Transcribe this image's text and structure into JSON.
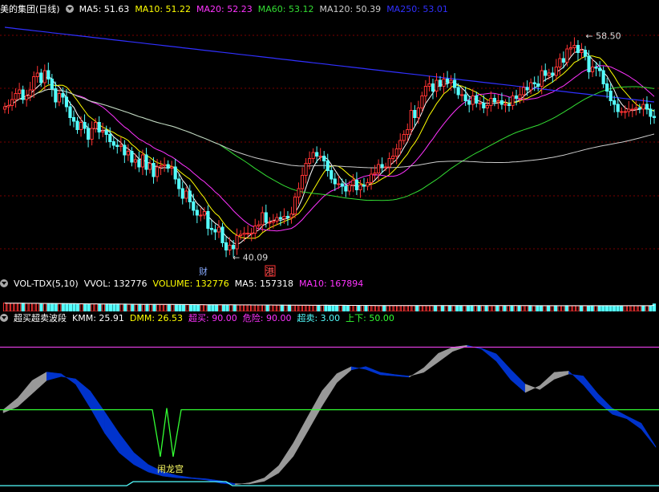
{
  "colors": {
    "up": "#ff3333",
    "down": "#54ffff",
    "ma5": "#ffffff",
    "ma10": "#ffff00",
    "ma20": "#ff33ff",
    "ma60": "#33dd33",
    "ma120": "#cccccc",
    "ma250": "#3030ff",
    "grid": "#7a0000",
    "kdj_up": "#999999",
    "kdj_down": "#0033cc",
    "green_line": "#33ff33",
    "pink_line": "#ff44ff"
  },
  "price_panel": {
    "title": "美的集团(日线)",
    "legend": [
      {
        "label": "MA5: 51.63",
        "color": "#ffffff"
      },
      {
        "label": "MA10: 51.22",
        "color": "#ffff00"
      },
      {
        "label": "MA20: 52.23",
        "color": "#ff33ff"
      },
      {
        "label": "MA60: 53.12",
        "color": "#33dd33"
      },
      {
        "label": "MA120: 50.39",
        "color": "#cccccc"
      },
      {
        "label": "MA250: 53.01",
        "color": "#3030ff"
      }
    ],
    "high_label": "58.50",
    "low_label": "40.09",
    "marker_cai": "财",
    "marker_gang": "港"
  },
  "volume_panel": {
    "legend": [
      {
        "label": "VOL-TDX(5,10)",
        "color": "#ffffff"
      },
      {
        "label": "VVOL: 132776",
        "color": "#ffffff"
      },
      {
        "label": "VOLUME: 132776",
        "color": "#ffff00"
      },
      {
        "label": "MA5: 157318",
        "color": "#ffffff"
      },
      {
        "label": "MA10: 167894",
        "color": "#ff33ff"
      }
    ]
  },
  "indicator_panel": {
    "legend": [
      {
        "label": "超买超卖波段",
        "color": "#ffffff"
      },
      {
        "label": "KMM: 25.91",
        "color": "#ffffff"
      },
      {
        "label": "DMM: 26.53",
        "color": "#ffff00"
      },
      {
        "label": "超买: 90.00",
        "color": "#ff33ff"
      },
      {
        "label": "危险: 90.00",
        "color": "#ff33ff"
      },
      {
        "label": "超卖: 3.00",
        "color": "#54ffff"
      },
      {
        "label": "上下: 50.00",
        "color": "#33ff33"
      }
    ],
    "annotation": "闹龙宫"
  },
  "chart_data": [
    {
      "type": "candlestick",
      "title": "美的集团(日线)",
      "x": [
        1,
        2,
        3,
        4,
        5,
        6,
        7,
        8,
        9,
        10,
        11,
        12,
        13,
        14,
        15,
        16,
        17,
        18,
        19,
        20,
        21,
        22,
        23,
        24,
        25,
        26,
        27,
        28,
        29,
        30,
        31,
        32,
        33,
        34,
        35,
        36,
        37,
        38,
        39,
        40,
        41,
        42,
        43,
        44,
        45,
        46,
        47,
        48,
        49,
        50,
        51,
        52,
        53,
        54,
        55,
        56,
        57,
        58,
        59,
        60,
        61,
        62,
        63,
        64,
        65,
        66,
        67,
        68,
        69,
        70,
        71,
        72,
        73,
        74,
        75,
        76,
        77,
        78,
        79,
        80,
        81,
        82,
        83,
        84,
        85,
        86,
        87,
        88,
        89,
        90,
        91,
        92,
        93,
        94,
        95,
        96,
        97,
        98,
        99,
        100,
        101,
        102,
        103,
        104,
        105,
        106,
        107,
        108,
        109,
        110,
        111,
        112,
        113,
        114,
        115,
        116,
        117,
        118,
        119,
        120,
        121,
        122,
        123,
        124,
        125,
        126,
        127,
        128,
        129,
        130,
        131,
        132,
        133,
        134,
        135,
        136,
        137,
        138,
        139,
        140,
        141,
        142,
        143,
        144,
        145,
        146,
        147,
        148,
        149,
        150,
        151,
        152,
        153,
        154,
        155,
        156,
        157,
        158,
        159,
        160,
        161,
        162,
        163,
        164,
        165,
        166,
        167,
        168,
        169,
        170,
        171,
        172,
        173,
        174,
        175,
        176,
        177,
        178,
        179,
        180
      ],
      "close": [
        52.6,
        52.7,
        53.2,
        53.7,
        54.0,
        53.2,
        53.5,
        54.0,
        55.1,
        55.4,
        54.6,
        55.6,
        54.9,
        54.1,
        53.0,
        53.7,
        53.4,
        52.6,
        51.7,
        51.4,
        50.7,
        51.3,
        50.8,
        49.9,
        50.8,
        51.3,
        50.5,
        50.6,
        50.3,
        49.7,
        49.4,
        49.3,
        49.4,
        48.6,
        48.9,
        48.0,
        48.2,
        47.6,
        48.6,
        47.4,
        47.9,
        46.8,
        47.6,
        47.7,
        47.8,
        47.5,
        47.6,
        46.6,
        45.8,
        45.0,
        45.6,
        44.7,
        44.0,
        43.6,
        43.6,
        43.9,
        42.5,
        42.4,
        42.2,
        42.6,
        41.3,
        40.7,
        41.1,
        40.8,
        41.9,
        42.0,
        42.1,
        42.1,
        42.1,
        42.7,
        42.8,
        43.8,
        43.0,
        43.0,
        43.1,
        43.4,
        43.3,
        43.5,
        43.4,
        43.7,
        45.1,
        45.8,
        46.9,
        47.9,
        48.3,
        48.8,
        48.5,
        48.5,
        48.1,
        47.3,
        46.6,
        46.2,
        46.2,
        46.0,
        45.6,
        46.1,
        46.5,
        45.7,
        46.1,
        46.0,
        46.3,
        47.0,
        47.1,
        47.8,
        47.6,
        47.6,
        48.3,
        48.5,
        49.1,
        49.8,
        50.3,
        50.7,
        52.3,
        51.7,
        52.5,
        53.5,
        54.3,
        54.5,
        53.9,
        54.8,
        54.3,
        54.9,
        54.6,
        54.8,
        54.2,
        53.6,
        53.6,
        53.1,
        52.8,
        53.5,
        52.9,
        52.9,
        52.5,
        52.7,
        53.3,
        53.0,
        53.1,
        52.8,
        52.8,
        52.7,
        53.5,
        53.3,
        53.6,
        54.2,
        54.0,
        54.6,
        54.5,
        54.3,
        55.6,
        55.2,
        55.4,
        55.2,
        55.9,
        56.6,
        56.3,
        57.4,
        57.5,
        57.7,
        57.1,
        57.3,
        56.8,
        55.5,
        55.9,
        55.8,
        55.6,
        54.5,
        53.9,
        53.1,
        52.8,
        52.2,
        52.2,
        52.2,
        52.4,
        52.4,
        52.5,
        52.4,
        52.8,
        52.4,
        51.8,
        51.7
      ],
      "low_label": 40.09,
      "high_label": 58.5
    },
    {
      "type": "bar",
      "title": "VOL-TDX(5,10)",
      "values": [
        148800,
        145300,
        145000,
        145500,
        144400,
        145000,
        143600,
        143500,
        143200,
        142800,
        140800,
        140700,
        140100,
        140100,
        139300,
        139700,
        139200,
        137300,
        136400,
        136700,
        134400,
        134300,
        134300,
        132800,
        133300,
        134500,
        132300,
        132200,
        131200,
        130800,
        130500,
        131000,
        128500,
        129900,
        126400,
        127700,
        125900,
        126600,
        125000,
        126000,
        125700,
        124600,
        124100,
        124300,
        123900,
        123000,
        122600,
        123300,
        122800,
        122000,
        120100,
        120100,
        118700,
        119400,
        119600,
        118000,
        118000,
        117800,
        117700,
        117700,
        117400,
        115900,
        116900,
        115800,
        115100,
        114700,
        114200,
        115900,
        114200,
        114400,
        114200,
        113100,
        114100,
        113200,
        112600,
        111700,
        110900,
        111500,
        112600,
        111200,
        109900,
        109100,
        108400,
        108700,
        109700,
        110000,
        108600,
        109300,
        109400,
        108200,
        109100,
        107700,
        107200,
        107200,
        105400,
        107300,
        106300,
        105900,
        106600,
        105800,
        104700,
        103800,
        103200,
        103500,
        104000,
        104800,
        104400,
        103900,
        103700,
        104100,
        103800,
        104700,
        104800,
        103500,
        104700,
        103400,
        103000,
        103900,
        102700,
        103000,
        103500,
        104000,
        103400,
        103900,
        104100,
        103000,
        103300,
        102700,
        103300,
        103500,
        102600,
        103300,
        103000,
        102200,
        102800,
        103100,
        103600,
        102500,
        103000,
        102400,
        103200,
        101800,
        102100,
        102300,
        102100,
        101400,
        102300,
        101800,
        101600,
        101700,
        102200,
        101800,
        100200,
        101600,
        102400,
        101400,
        101700,
        100300,
        100400,
        101800,
        100200,
        101400,
        100700,
        101200,
        100800,
        101400,
        101200,
        100800,
        101700,
        100800,
        101300,
        101700,
        101900,
        100700,
        101900,
        101100,
        101400,
        101600,
        132776
      ],
      "series_ma5_last": 157318,
      "series_ma10_last": 167894
    },
    {
      "type": "area",
      "title": "超买超卖波段",
      "series": [
        {
          "name": "KMM",
          "values": [
            50.0,
            57.5,
            68.7,
            74.1,
            73.0,
            66.2,
            51.2,
            35.0,
            22.5,
            15.0,
            10.2,
            7.6,
            6.5,
            6.0,
            5.1,
            3.0,
            2.1,
            3.4,
            6.4,
            14.3,
            28.6,
            45.6,
            62.2,
            73.0,
            77.5,
            75.8,
            72.3,
            71.6,
            70.8,
            76.8,
            86.0,
            90.0,
            91.2,
            88.6,
            81.0,
            69.1,
            61.0,
            65.4,
            73.9,
            74.7,
            65.9,
            55.0,
            47.1,
            44.2,
            37.6,
            25.91
          ]
        },
        {
          "name": "DMM",
          "values": [
            48.0,
            52.0,
            60.3,
            68.7,
            71.2,
            69.7,
            62.0,
            48.7,
            34.9,
            22.7,
            15.0,
            10.4,
            8.0,
            6.6,
            5.9,
            4.6,
            2.8,
            2.6,
            4.3,
            9.6,
            20.2,
            36.3,
            52.6,
            67.3,
            75.4,
            77.6,
            73.9,
            72.5,
            71.5,
            73.9,
            80.5,
            87.3,
            90.5,
            89.2,
            85.7,
            75.7,
            66.4,
            62.9,
            69.5,
            72.8,
            71.6,
            60.3,
            51.0,
            46.0,
            41.4,
            26.53
          ]
        }
      ],
      "thresholds": {
        "超买": 90.0,
        "危险": 90.0,
        "超卖": 3.0,
        "上下": 50.0
      },
      "annotation": "闹龙宫"
    }
  ]
}
